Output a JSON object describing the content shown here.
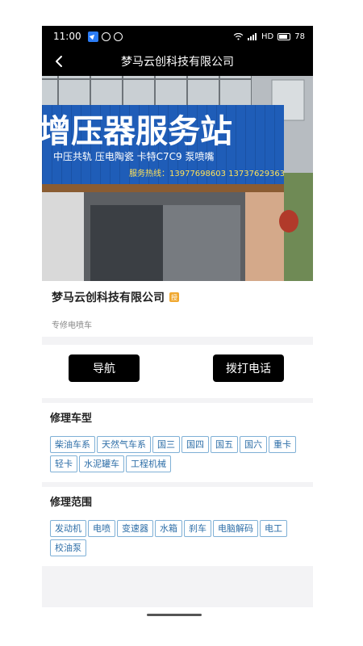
{
  "status_bar": {
    "time": "11:00",
    "network": "HD",
    "battery": "78"
  },
  "nav": {
    "title": "梦马云创科技有限公司"
  },
  "photo": {
    "sign_main": "增压器服务站",
    "sign_line2": "中压共轨  压电陶瓷  卡特C7C9  泵喷嘴",
    "sign_line3": "服务热线：13977698603  13737629363"
  },
  "company": {
    "name": "梦马云创科技有限公司",
    "badge": "授",
    "subtitle": "专修电喷车"
  },
  "actions": {
    "navigate_label": "导航",
    "call_label": "拨打电话"
  },
  "repair_models": {
    "title": "修理车型",
    "tags": [
      "柴油车系",
      "天然气车系",
      "国三",
      "国四",
      "国五",
      "国六",
      "重卡",
      "轻卡",
      "水泥罐车",
      "工程机械"
    ]
  },
  "repair_scope": {
    "title": "修理范围",
    "tags": [
      "发动机",
      "电喷",
      "变速器",
      "水箱",
      "刹车",
      "电脑解码",
      "电工",
      "校油泵"
    ]
  },
  "colors": {
    "tag_border": "#7fb0d6",
    "tag_text": "#2f6fa8",
    "sign_blue": "#1f5db8",
    "badge": "#f0a830"
  }
}
